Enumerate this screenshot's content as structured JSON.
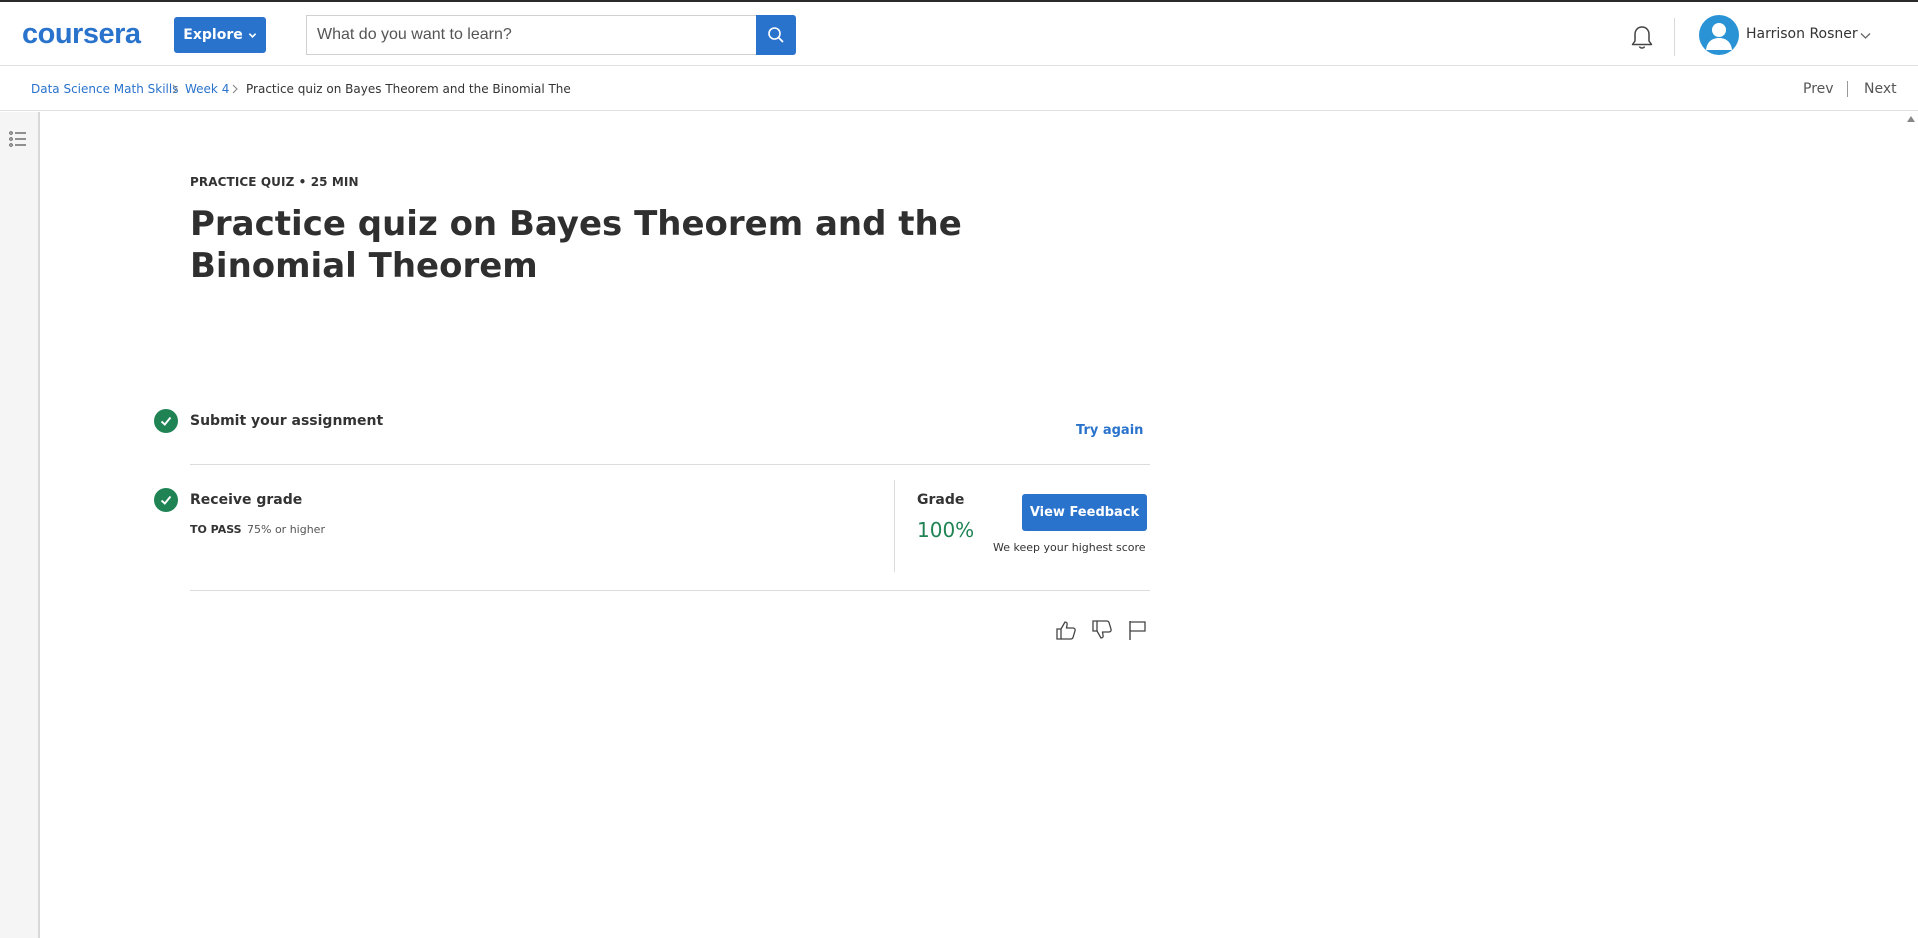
{
  "header": {
    "logo_text": "coursera",
    "explore_label": "Explore",
    "search_placeholder": "What do you want to learn?",
    "user_name": "Harrison Rosner"
  },
  "breadcrumb": {
    "items": [
      "Data Science Math Skills",
      "Week 4",
      "Practice quiz on Bayes Theorem and the Binomial The"
    ]
  },
  "nav": {
    "prev_label": "Prev",
    "next_label": "Next"
  },
  "quiz": {
    "eyebrow": "PRACTICE QUIZ • 25 MIN",
    "title": "Practice quiz on Bayes Theorem and the Binomial Theorem",
    "submit_step": {
      "label": "Submit your assignment",
      "action_label": "Try again"
    },
    "grade_step": {
      "label": "Receive grade",
      "pass_label": "TO PASS",
      "pass_value": "75% or higher",
      "grade_label": "Grade",
      "grade_value": "100%",
      "feedback_button": "View Feedback",
      "keep_note": "We keep your highest score"
    }
  },
  "icons": {
    "bell": "bell-icon",
    "search": "search-icon",
    "avatar": "user-avatar-icon",
    "outline": "list-icon",
    "like": "thumbs-up-icon",
    "dislike": "thumbs-down-icon",
    "flag": "flag-icon"
  },
  "colors": {
    "brand_blue": "#2a73cc",
    "success_green": "#1f8354",
    "avatar_blue": "#2a93d5"
  }
}
